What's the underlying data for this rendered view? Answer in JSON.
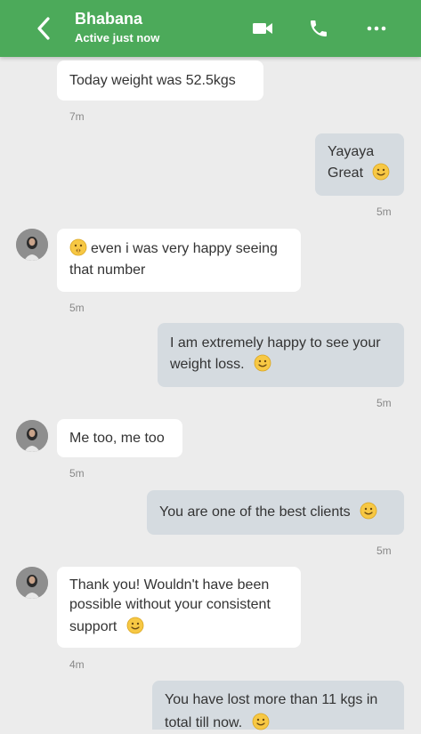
{
  "header": {
    "contact_name": "Bhabana",
    "status": "Active just now",
    "icons": [
      "back-arrow-icon",
      "video-camera-icon",
      "phone-icon",
      "more-dots-icon"
    ],
    "color": "#4caa5a"
  },
  "messages": [
    {
      "direction": "in",
      "lines": [
        "Today weight  was 52.5kgs"
      ],
      "time": "7m"
    },
    {
      "direction": "out",
      "lines": [
        "Yayaya",
        "Great"
      ],
      "emoji": "smile",
      "time": "5m"
    },
    {
      "direction": "in",
      "lines": [
        "even i was very happy seeing",
        "that number"
      ],
      "emoji_start": "shushing",
      "time": "5m"
    },
    {
      "direction": "out",
      "lines": [
        "I am extremely happy to see your",
        "weight loss."
      ],
      "emoji": "smile",
      "time": "5m"
    },
    {
      "direction": "in",
      "lines": [
        "Me too, me too"
      ],
      "time": "5m"
    },
    {
      "direction": "out",
      "lines": [
        "You are one of the best clients"
      ],
      "emoji": "smile",
      "time": "5m"
    },
    {
      "direction": "in",
      "lines": [
        "Thank you! Wouldn't have been",
        "possible without your consistent",
        "support"
      ],
      "emoji": "smile",
      "time": "4m"
    },
    {
      "direction": "out",
      "lines": [
        "You have lost more than 11 kgs in",
        "total till now."
      ],
      "emoji": "smile",
      "time": ""
    }
  ]
}
